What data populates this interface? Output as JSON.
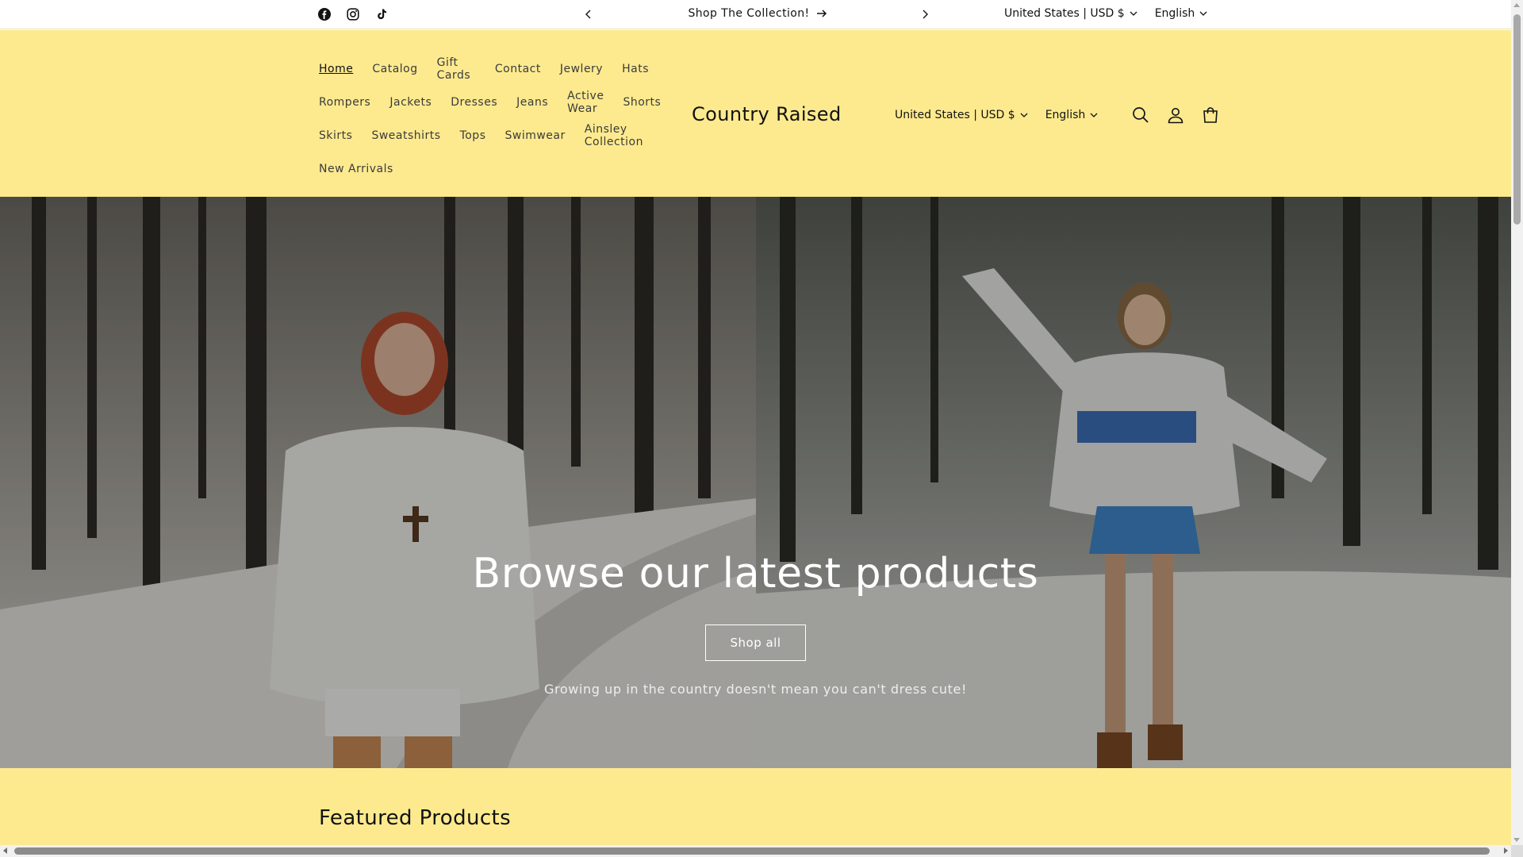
{
  "announcement": {
    "social": [
      "facebook-icon",
      "instagram-icon",
      "tiktok-icon"
    ],
    "message": "Shop The Collection!",
    "country": "United States | USD $",
    "language": "English"
  },
  "header": {
    "brand": "Country Raised",
    "nav_rows": [
      [
        "Home",
        "Catalog",
        "Gift Cards",
        "Contact",
        "Jewlery",
        "Hats"
      ],
      [
        "Rompers",
        "Jackets",
        "Dresses",
        "Jeans",
        "Active Wear",
        "Shorts"
      ],
      [
        "Skirts",
        "Sweatshirts",
        "Tops",
        "Swimwear",
        "Ainsley Collection"
      ],
      [
        "New Arrivals"
      ]
    ],
    "active_item": "Home",
    "country": "United States | USD $",
    "language": "English",
    "icons": [
      "search-icon",
      "account-icon",
      "cart-icon"
    ]
  },
  "hero": {
    "title": "Browse our latest products",
    "button_label": "Shop all",
    "subtitle": "Growing up in the country doesn't mean you can't dress cute!"
  },
  "featured": {
    "title": "Featured Products"
  },
  "colors": {
    "header_bg": "#fdea8f",
    "text": "#121212"
  }
}
